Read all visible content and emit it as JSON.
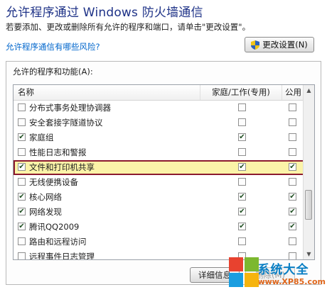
{
  "header": {
    "title": "允许程序通过 Windows 防火墙通信",
    "subtitle": "若要添加、更改或删除所有允许的程序和端口，请单击\"更改设置\"。",
    "risk_link": "允许程序通信有哪些风险?",
    "change_settings_label": "更改设置(N)"
  },
  "group": {
    "label": "允许的程序和功能(A):",
    "columns": {
      "name": "名称",
      "home_work": "家庭/工作(专用)",
      "public": "公用"
    },
    "rows": [
      {
        "name": "分布式事务处理协调器",
        "enabled": false,
        "home": false,
        "public": false
      },
      {
        "name": "安全套接字隧道协议",
        "enabled": false,
        "home": false,
        "public": false
      },
      {
        "name": "家庭组",
        "enabled": true,
        "home": true,
        "public": false
      },
      {
        "name": "性能日志和警报",
        "enabled": false,
        "home": false,
        "public": false
      },
      {
        "name": "文件和打印机共享",
        "enabled": true,
        "home": true,
        "public": true,
        "highlighted": true
      },
      {
        "name": "无线便携设备",
        "enabled": false,
        "home": false,
        "public": false
      },
      {
        "name": "核心网络",
        "enabled": true,
        "home": true,
        "public": true
      },
      {
        "name": "网络发现",
        "enabled": true,
        "home": true,
        "public": true
      },
      {
        "name": "腾讯QQ2009",
        "enabled": true,
        "home": true,
        "public": true
      },
      {
        "name": "路由和远程访问",
        "enabled": false,
        "home": false,
        "public": false
      },
      {
        "name": "远程事件日志管理",
        "enabled": false,
        "home": false,
        "public": false
      }
    ],
    "details_label": "详细信息",
    "delete_label": "删除(M)"
  },
  "watermark": {
    "text": "系统大全",
    "url": "www.XP85.com"
  },
  "colors": {
    "title": "#1e3287",
    "link": "#0066cc",
    "highlight_border": "#8b1a2e",
    "highlight_fill": "#fbf3a8"
  }
}
